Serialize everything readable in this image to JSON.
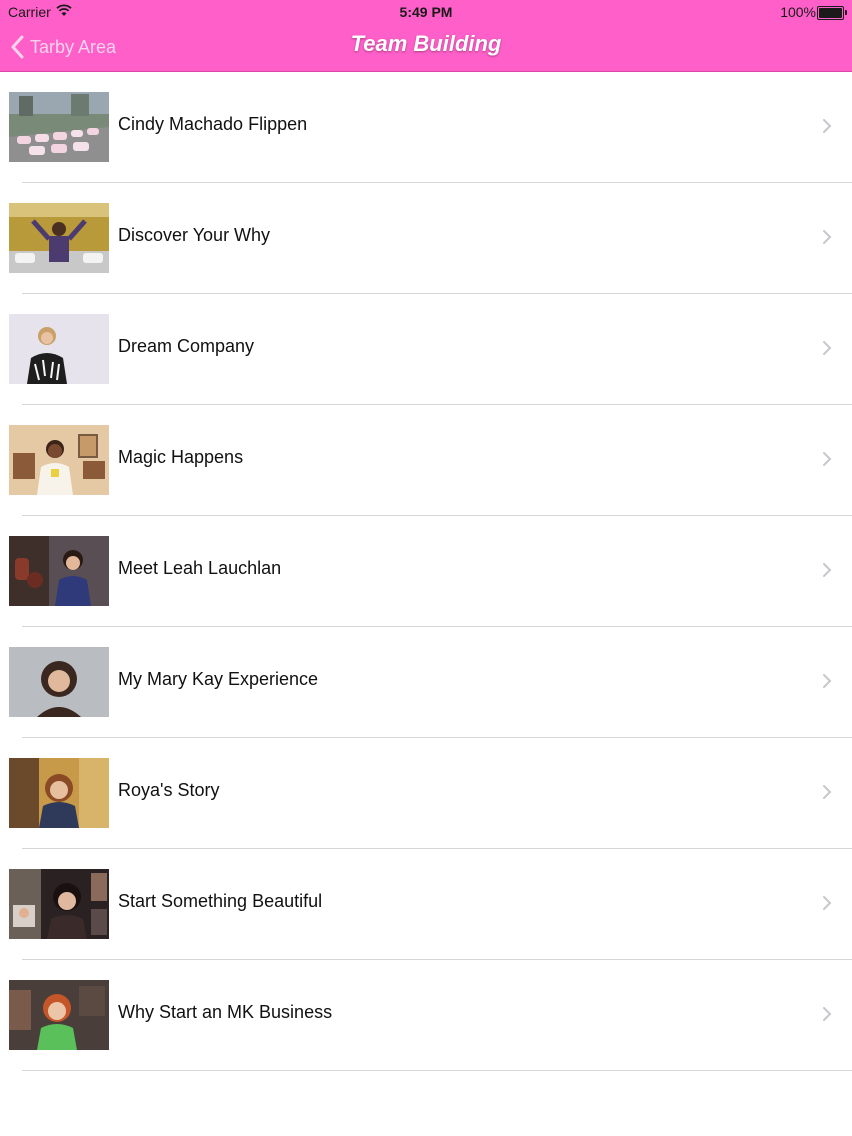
{
  "status_bar": {
    "carrier": "Carrier",
    "time": "5:49 PM",
    "battery": "100%"
  },
  "nav": {
    "back_label": "Tarby Area",
    "title": "Team Building"
  },
  "colors": {
    "nav_bar": "#ff5fc8",
    "back_text": "#f6d3ec",
    "chevron": "#c7c7cc",
    "separator": "#d6d6d6"
  },
  "items": [
    {
      "label": "Cindy Machado Flippen",
      "thumb_icon": "pink-cars-thumbnail"
    },
    {
      "label": "Discover Your Why",
      "thumb_icon": "celebration-thumbnail"
    },
    {
      "label": "Dream Company",
      "thumb_icon": "speaker-thumbnail"
    },
    {
      "label": "Magic Happens",
      "thumb_icon": "speaker-living-room-thumbnail"
    },
    {
      "label": "Meet Leah Lauchlan",
      "thumb_icon": "speaker-thumbnail"
    },
    {
      "label": "My Mary Kay Experience",
      "thumb_icon": "speaker-thumbnail"
    },
    {
      "label": "Roya's Story",
      "thumb_icon": "speaker-thumbnail"
    },
    {
      "label": "Start Something Beautiful",
      "thumb_icon": "speaker-collage-thumbnail"
    },
    {
      "label": "Why Start an MK Business",
      "thumb_icon": "speaker-thumbnail"
    }
  ]
}
